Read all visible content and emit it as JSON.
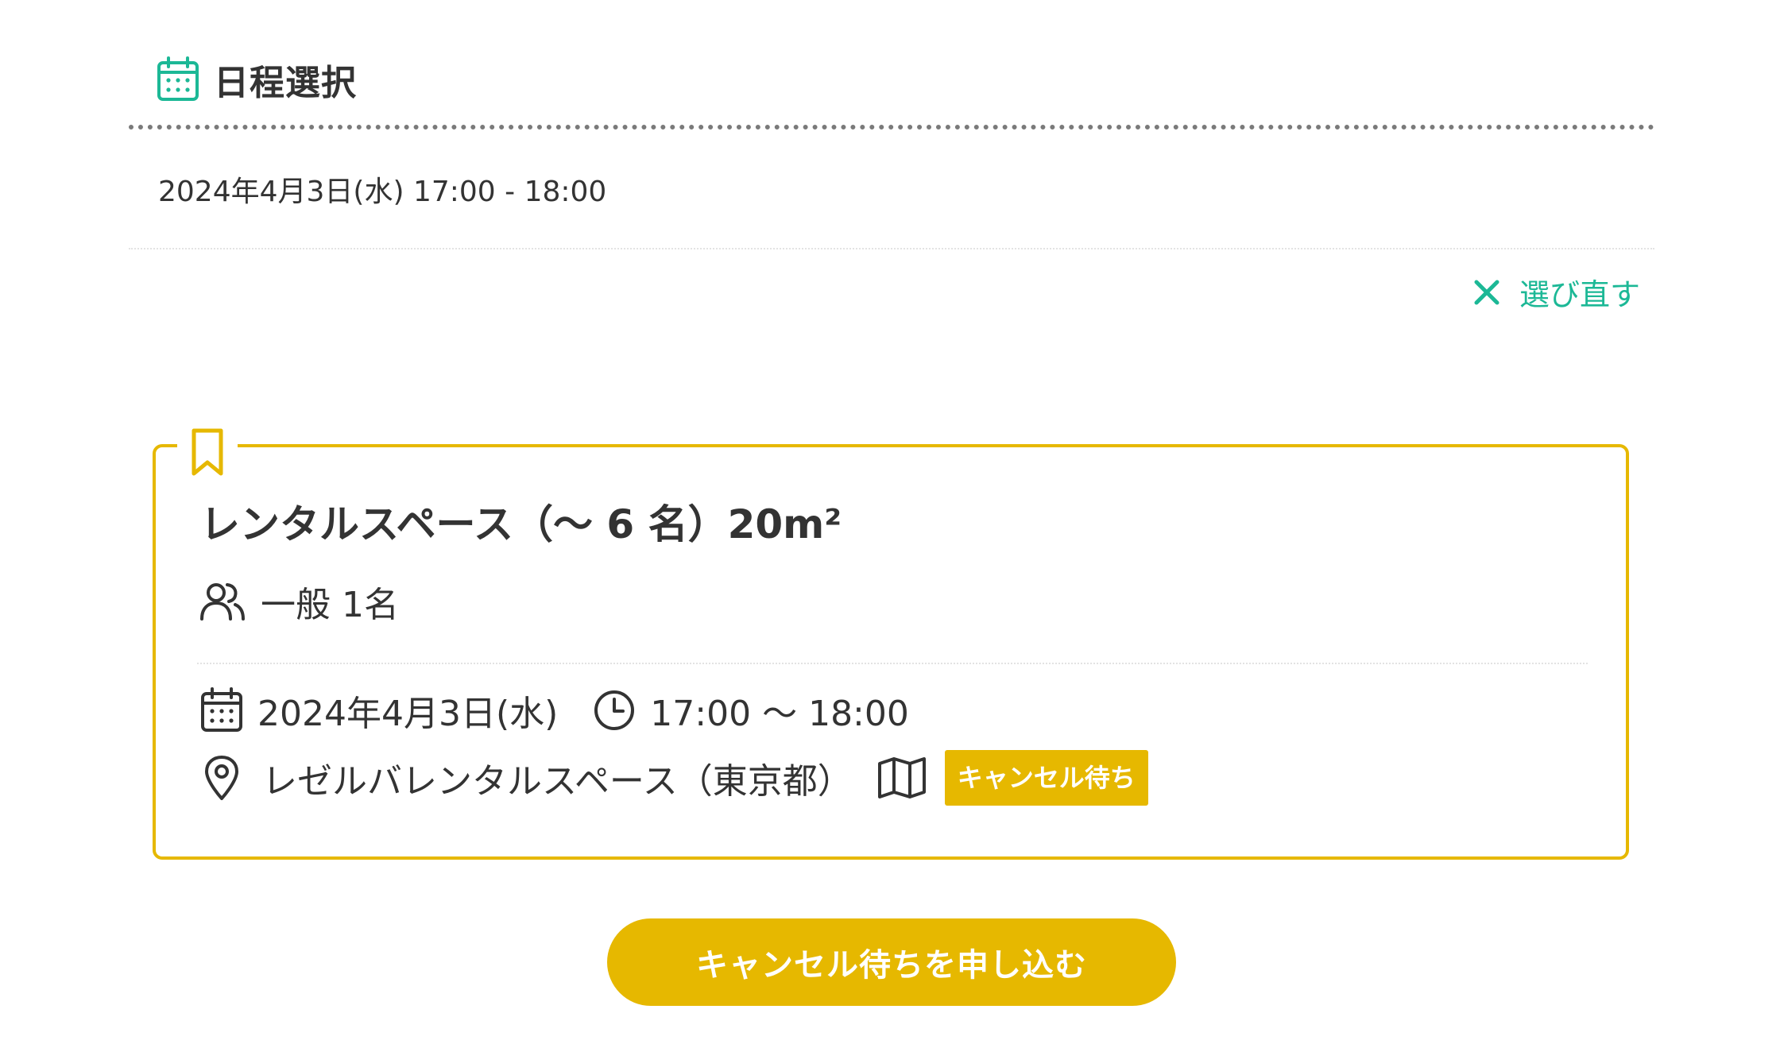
{
  "section": {
    "title": "日程選択",
    "icon": "calendar-icon"
  },
  "selected_schedule": {
    "datetime": "2024年4月3日(水) 17:00 - 18:00"
  },
  "reselect": {
    "label": "選び直す",
    "icon": "close-icon"
  },
  "plan_card": {
    "title": "レンタルスペース（〜 6 名）20m²",
    "participants": "一般 1名",
    "date": "2024年4月3日(水)",
    "time": "17:00 〜 18:00",
    "venue": "レゼルバレンタルスペース（東京都）",
    "status_badge": "キャンセル待ち"
  },
  "submit": {
    "label": "キャンセル待ちを申し込む"
  },
  "colors": {
    "accent_green": "#1cb896",
    "accent_yellow": "#e6b800",
    "text": "#333333"
  }
}
